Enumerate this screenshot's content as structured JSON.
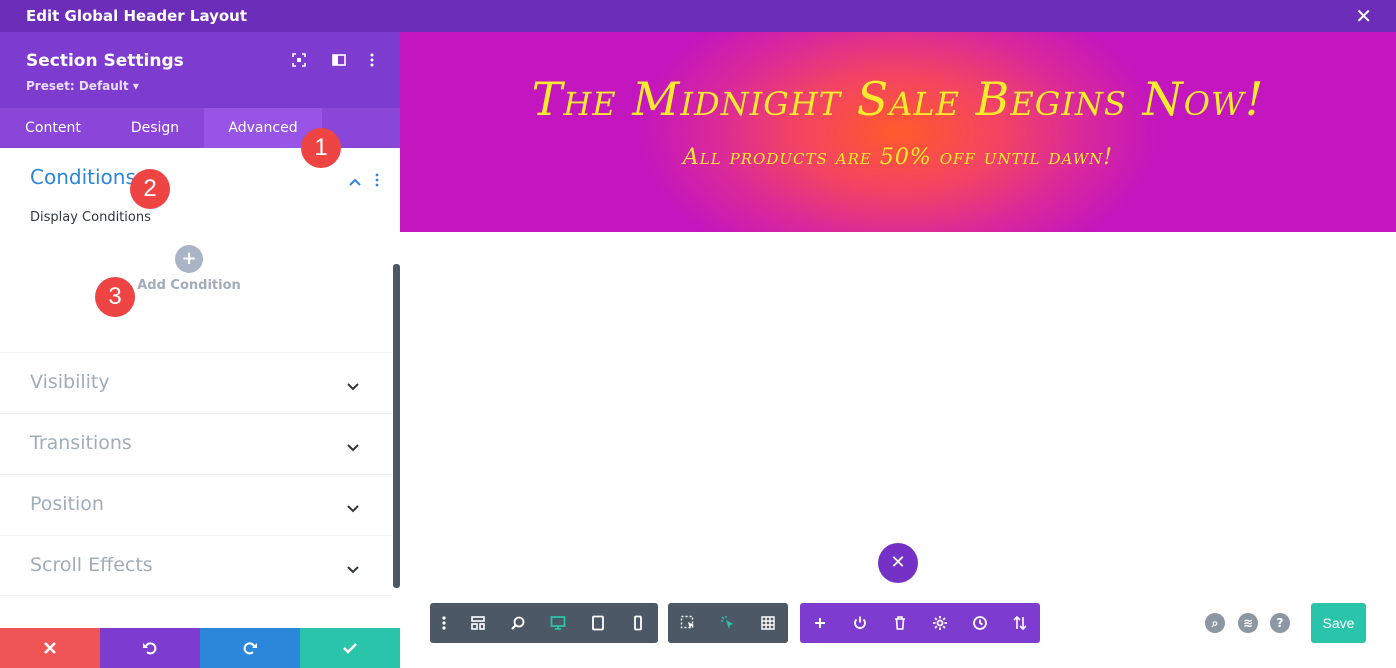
{
  "window": {
    "title": "Edit Global Header Layout",
    "close_icon": "close-icon"
  },
  "panel": {
    "title": "Section Settings",
    "preset": "Preset: Default ▾",
    "tabs": [
      {
        "label": "Content",
        "active": false
      },
      {
        "label": "Design",
        "active": false
      },
      {
        "label": "Advanced",
        "active": true
      }
    ],
    "open_section": {
      "title": "Conditions",
      "field_label": "Display Conditions",
      "add_label": "Add Condition"
    },
    "groups": [
      {
        "label": "Visibility"
      },
      {
        "label": "Transitions"
      },
      {
        "label": "Position"
      },
      {
        "label": "Scroll Effects"
      }
    ]
  },
  "badges": [
    "1",
    "2",
    "3"
  ],
  "banner": {
    "headline": "The Midnight Sale Begins Now!",
    "subline": "All products are 50% off until dawn!"
  },
  "toolbar": {
    "save_label": "Save"
  },
  "colors": {
    "topbar": "#6c2eb9",
    "panel_header": "#7e3bd0",
    "tab_active": "#9754e6",
    "accent_blue": "#2b87da",
    "badge_red": "#ef4444",
    "cancel": "#ef5555",
    "undo": "#7e3bd0",
    "redo": "#2b87da",
    "confirm": "#29c4a9",
    "banner_text": "#f6ec2b",
    "dark_toolbar": "#4c5866",
    "purple_toolbar": "#7e3bd0",
    "save": "#29c4a9"
  }
}
